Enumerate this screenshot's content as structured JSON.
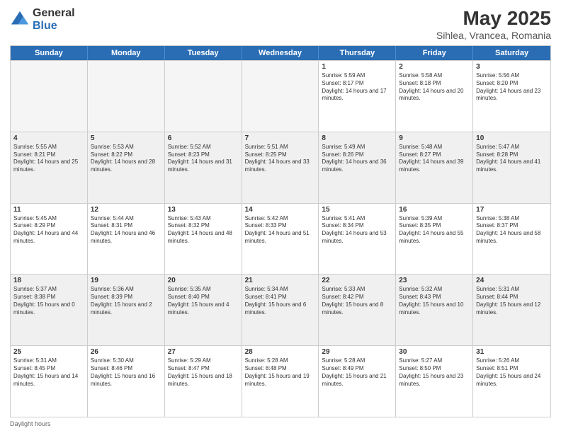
{
  "header": {
    "logo_general": "General",
    "logo_blue": "Blue",
    "title": "May 2025",
    "location": "Sihlea, Vrancea, Romania"
  },
  "calendar": {
    "days_of_week": [
      "Sunday",
      "Monday",
      "Tuesday",
      "Wednesday",
      "Thursday",
      "Friday",
      "Saturday"
    ],
    "footer": "Daylight hours"
  },
  "weeks": [
    [
      {
        "day": "",
        "empty": true
      },
      {
        "day": "",
        "empty": true
      },
      {
        "day": "",
        "empty": true
      },
      {
        "day": "",
        "empty": true
      },
      {
        "day": "1",
        "sunrise": "5:59 AM",
        "sunset": "8:17 PM",
        "daylight": "14 hours and 17 minutes."
      },
      {
        "day": "2",
        "sunrise": "5:58 AM",
        "sunset": "8:18 PM",
        "daylight": "14 hours and 20 minutes."
      },
      {
        "day": "3",
        "sunrise": "5:56 AM",
        "sunset": "8:20 PM",
        "daylight": "14 hours and 23 minutes."
      }
    ],
    [
      {
        "day": "4",
        "sunrise": "5:55 AM",
        "sunset": "8:21 PM",
        "daylight": "14 hours and 25 minutes."
      },
      {
        "day": "5",
        "sunrise": "5:53 AM",
        "sunset": "8:22 PM",
        "daylight": "14 hours and 28 minutes."
      },
      {
        "day": "6",
        "sunrise": "5:52 AM",
        "sunset": "8:23 PM",
        "daylight": "14 hours and 31 minutes."
      },
      {
        "day": "7",
        "sunrise": "5:51 AM",
        "sunset": "8:25 PM",
        "daylight": "14 hours and 33 minutes."
      },
      {
        "day": "8",
        "sunrise": "5:49 AM",
        "sunset": "8:26 PM",
        "daylight": "14 hours and 36 minutes."
      },
      {
        "day": "9",
        "sunrise": "5:48 AM",
        "sunset": "8:27 PM",
        "daylight": "14 hours and 39 minutes."
      },
      {
        "day": "10",
        "sunrise": "5:47 AM",
        "sunset": "8:28 PM",
        "daylight": "14 hours and 41 minutes."
      }
    ],
    [
      {
        "day": "11",
        "sunrise": "5:45 AM",
        "sunset": "8:29 PM",
        "daylight": "14 hours and 44 minutes."
      },
      {
        "day": "12",
        "sunrise": "5:44 AM",
        "sunset": "8:31 PM",
        "daylight": "14 hours and 46 minutes."
      },
      {
        "day": "13",
        "sunrise": "5:43 AM",
        "sunset": "8:32 PM",
        "daylight": "14 hours and 48 minutes."
      },
      {
        "day": "14",
        "sunrise": "5:42 AM",
        "sunset": "8:33 PM",
        "daylight": "14 hours and 51 minutes."
      },
      {
        "day": "15",
        "sunrise": "5:41 AM",
        "sunset": "8:34 PM",
        "daylight": "14 hours and 53 minutes."
      },
      {
        "day": "16",
        "sunrise": "5:39 AM",
        "sunset": "8:35 PM",
        "daylight": "14 hours and 55 minutes."
      },
      {
        "day": "17",
        "sunrise": "5:38 AM",
        "sunset": "8:37 PM",
        "daylight": "14 hours and 58 minutes."
      }
    ],
    [
      {
        "day": "18",
        "sunrise": "5:37 AM",
        "sunset": "8:38 PM",
        "daylight": "15 hours and 0 minutes."
      },
      {
        "day": "19",
        "sunrise": "5:36 AM",
        "sunset": "8:39 PM",
        "daylight": "15 hours and 2 minutes."
      },
      {
        "day": "20",
        "sunrise": "5:35 AM",
        "sunset": "8:40 PM",
        "daylight": "15 hours and 4 minutes."
      },
      {
        "day": "21",
        "sunrise": "5:34 AM",
        "sunset": "8:41 PM",
        "daylight": "15 hours and 6 minutes."
      },
      {
        "day": "22",
        "sunrise": "5:33 AM",
        "sunset": "8:42 PM",
        "daylight": "15 hours and 8 minutes."
      },
      {
        "day": "23",
        "sunrise": "5:32 AM",
        "sunset": "8:43 PM",
        "daylight": "15 hours and 10 minutes."
      },
      {
        "day": "24",
        "sunrise": "5:31 AM",
        "sunset": "8:44 PM",
        "daylight": "15 hours and 12 minutes."
      }
    ],
    [
      {
        "day": "25",
        "sunrise": "5:31 AM",
        "sunset": "8:45 PM",
        "daylight": "15 hours and 14 minutes."
      },
      {
        "day": "26",
        "sunrise": "5:30 AM",
        "sunset": "8:46 PM",
        "daylight": "15 hours and 16 minutes."
      },
      {
        "day": "27",
        "sunrise": "5:29 AM",
        "sunset": "8:47 PM",
        "daylight": "15 hours and 18 minutes."
      },
      {
        "day": "28",
        "sunrise": "5:28 AM",
        "sunset": "8:48 PM",
        "daylight": "15 hours and 19 minutes."
      },
      {
        "day": "29",
        "sunrise": "5:28 AM",
        "sunset": "8:49 PM",
        "daylight": "15 hours and 21 minutes."
      },
      {
        "day": "30",
        "sunrise": "5:27 AM",
        "sunset": "8:50 PM",
        "daylight": "15 hours and 23 minutes."
      },
      {
        "day": "31",
        "sunrise": "5:26 AM",
        "sunset": "8:51 PM",
        "daylight": "15 hours and 24 minutes."
      }
    ]
  ]
}
